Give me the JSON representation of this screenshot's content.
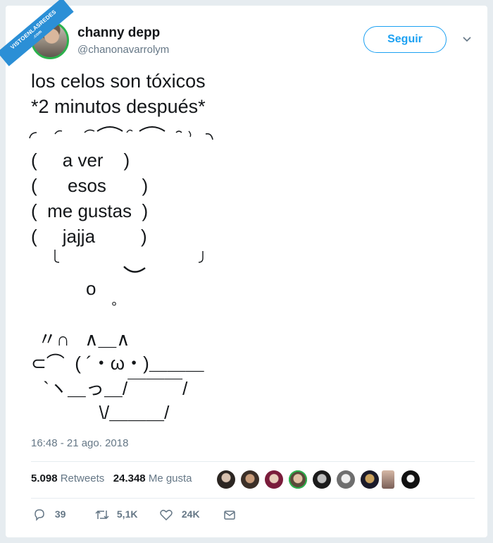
{
  "watermark": {
    "line1": "VISTOENLASREDES",
    "line2": ".com"
  },
  "user": {
    "display_name": "channy depp",
    "handle": "@chanonavarrolym",
    "follow_label": "Seguir"
  },
  "tweet": {
    "line1": "los celos son tóxicos",
    "line2": "*2 minutos después*",
    "art": {
      "bubble_top": "╭ ⌒ ⌒ ⌒ ⌒ ⌒ ╮",
      "row1": "(     a ver    )",
      "row2": "(      esos       )",
      "row3": "(  me gustas  )",
      "row4": "(     jajja         )",
      "bubble_bottom": "╰ ‿  ‿  ‿  ‿ ╯",
      "dot_big": "o",
      "dot_small": "°",
      "rabbit1": "〃∩   ∧＿∧",
      "rabbit2": "⊂⌒  ( ´・ω・)＿＿＿",
      "rabbit3": " `ヽ＿っ＿/￣￣￣/",
      "rabbit4": "            \\/＿＿＿/"
    }
  },
  "meta": {
    "timestamp": "16:48 - 21 ago. 2018",
    "retweets_count": "5.098",
    "retweets_label": "Retweets",
    "likes_count": "24.348",
    "likes_label": "Me gusta"
  },
  "actions": {
    "replies": "39",
    "retweets": "5,1K",
    "likes": "24K"
  },
  "colors": {
    "accent": "#1da1f2",
    "text": "#14171a",
    "muted": "#657786"
  }
}
